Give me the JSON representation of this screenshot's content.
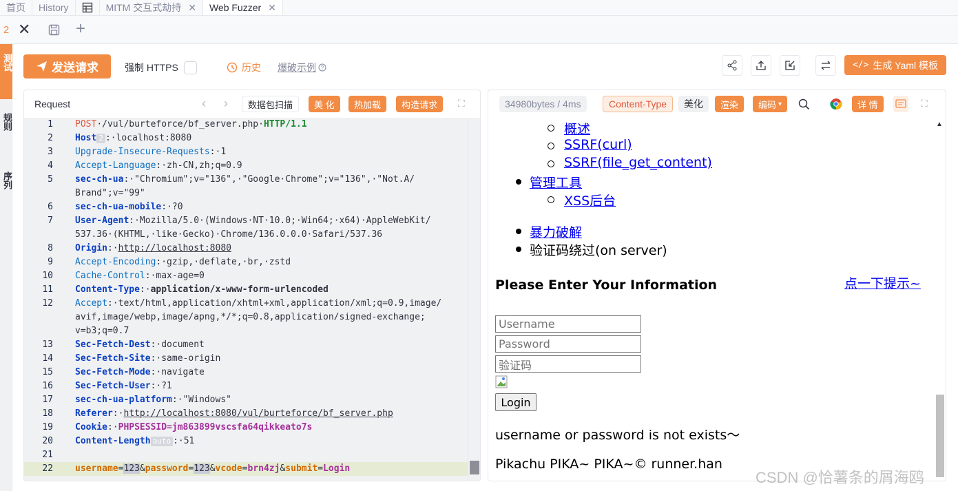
{
  "tabs": [
    "首页",
    "History",
    "MITM 交互式劫持",
    "Web Fuzzer"
  ],
  "subtab": {
    "number": "2"
  },
  "sidebar": {
    "labels": [
      "测试",
      "规则",
      "序列"
    ]
  },
  "toolbar": {
    "send_label": "发送请求",
    "https_label": "强制 HTTPS",
    "history_label": "历史",
    "example_label": "爆破示例",
    "yaml_label": "生成 Yaml 模板"
  },
  "request": {
    "title": "Request",
    "scan_label": "数据包扫描",
    "beautify_label": "美 化",
    "hotload_label": "热加载",
    "construct_label": "构造请求",
    "lines": [
      {
        "n": "1",
        "parts": [
          [
            "meth",
            "POST"
          ],
          [
            "val",
            "·/vul/burteforce/bf_server.php·"
          ],
          [
            "proto",
            "HTTP/1.1"
          ]
        ]
      },
      {
        "n": "2",
        "parts": [
          [
            "kb",
            "Host"
          ],
          [
            "tag",
            "2"
          ],
          [
            "val",
            ":·localhost:8080"
          ]
        ]
      },
      {
        "n": "3",
        "parts": [
          [
            "kn",
            "Upgrade-Insecure-Requests"
          ],
          [
            "val",
            ":·1"
          ]
        ]
      },
      {
        "n": "4",
        "parts": [
          [
            "kn",
            "Accept-Language"
          ],
          [
            "val",
            ":·zh-CN,zh;q=0.9"
          ]
        ]
      },
      {
        "n": "5",
        "parts": [
          [
            "kb",
            "sec-ch-ua"
          ],
          [
            "val",
            ":·\"Chromium\";v=\"136\",·\"Google·Chrome\";v=\"136\",·\"Not.A/\nBrand\";v=\"99\""
          ]
        ]
      },
      {
        "n": "6",
        "parts": [
          [
            "kb",
            "sec-ch-ua-mobile"
          ],
          [
            "val",
            ":·?0"
          ]
        ]
      },
      {
        "n": "7",
        "parts": [
          [
            "kb",
            "User-Agent"
          ],
          [
            "val",
            ":·Mozilla/5.0·(Windows·NT·10.0;·Win64;·x64)·AppleWebKit/\n537.36·(KHTML,·like·Gecko)·Chrome/136.0.0.0·Safari/537.36"
          ]
        ]
      },
      {
        "n": "8",
        "parts": [
          [
            "kb",
            "Origin"
          ],
          [
            "val",
            ":·"
          ],
          [
            "ul",
            "http://localhost:8080"
          ]
        ]
      },
      {
        "n": "9",
        "parts": [
          [
            "kn",
            "Accept-Encoding"
          ],
          [
            "val",
            ":·gzip,·deflate,·br,·zstd"
          ]
        ]
      },
      {
        "n": "10",
        "parts": [
          [
            "kn",
            "Cache-Control"
          ],
          [
            "val",
            ":·max-age=0"
          ]
        ]
      },
      {
        "n": "11",
        "parts": [
          [
            "kb",
            "Content-Type"
          ],
          [
            "val",
            ":·"
          ],
          [
            "bold",
            "application/x-www-form-urlencoded"
          ]
        ]
      },
      {
        "n": "12",
        "parts": [
          [
            "kn",
            "Accept"
          ],
          [
            "val",
            ":·text/html,application/xhtml+xml,application/xml;q=0.9,image/\navif,image/webp,image/apng,*/*;q=0.8,application/signed-exchange;\nv=b3;q=0.7"
          ]
        ]
      },
      {
        "n": "13",
        "parts": [
          [
            "kb",
            "Sec-Fetch-Dest"
          ],
          [
            "val",
            ":·document"
          ]
        ]
      },
      {
        "n": "14",
        "parts": [
          [
            "kb",
            "Sec-Fetch-Site"
          ],
          [
            "val",
            ":·same-origin"
          ]
        ]
      },
      {
        "n": "15",
        "parts": [
          [
            "kb",
            "Sec-Fetch-Mode"
          ],
          [
            "val",
            ":·navigate"
          ]
        ]
      },
      {
        "n": "16",
        "parts": [
          [
            "kb",
            "Sec-Fetch-User"
          ],
          [
            "val",
            ":·?1"
          ]
        ]
      },
      {
        "n": "17",
        "parts": [
          [
            "kb",
            "sec-ch-ua-platform"
          ],
          [
            "val",
            ":·\"Windows\""
          ]
        ]
      },
      {
        "n": "18",
        "parts": [
          [
            "kb",
            "Referer"
          ],
          [
            "val",
            ":·"
          ],
          [
            "ul",
            "http://localhost:8080/vul/burteforce/bf_server.php"
          ]
        ]
      },
      {
        "n": "19",
        "parts": [
          [
            "kb",
            "Cookie"
          ],
          [
            "val",
            ":·"
          ],
          [
            "ck",
            "PHPSESSID=jm863899vscsfa64qikkeato7s"
          ]
        ]
      },
      {
        "n": "20",
        "parts": [
          [
            "kb",
            "Content-Length"
          ],
          [
            "tag",
            "auto"
          ],
          [
            "val",
            ":·51"
          ]
        ]
      },
      {
        "n": "21",
        "parts": []
      },
      {
        "n": "22",
        "parts": [
          [
            "body-k",
            "username"
          ],
          [
            "val",
            "="
          ],
          [
            "body-h",
            "123"
          ],
          [
            "val",
            "&"
          ],
          [
            "body-k",
            "password"
          ],
          [
            "val",
            "="
          ],
          [
            "body-h",
            "123"
          ],
          [
            "val",
            "&"
          ],
          [
            "body-k",
            "vcode"
          ],
          [
            "val",
            "="
          ],
          [
            "body-v",
            "brn4zj"
          ],
          [
            "val",
            "&"
          ],
          [
            "body-k",
            "submit"
          ],
          [
            "val",
            "="
          ],
          [
            "body-v",
            "Login"
          ]
        ],
        "hl": true
      }
    ]
  },
  "response": {
    "size_label": "34980bytes / 4ms",
    "content_type_label": "Content-Type",
    "beautify_label": "美化",
    "render_label": "渲染",
    "encode_label": "编码",
    "detail_label": "详 情",
    "links_sub1": [
      "概述",
      "SSRF(curl)",
      "SSRF(file_get_content)"
    ],
    "menu_tools": "管理工具",
    "links_sub2": [
      "XSS后台"
    ],
    "menu_brute": "暴力破解",
    "menu_captcha": "验证码绕过(on server)",
    "heading": "Please Enter Your Information",
    "hint_link": "点一下提示~",
    "username_placeholder": "Username",
    "password_placeholder": "Password",
    "captcha_placeholder": "验证码",
    "login_label": "Login",
    "error_msg": "username or password is not exists～",
    "footer": "Pikachu PIKA~ PIKA~© runner.han"
  },
  "watermark": "CSDN @恰薯条的屑海鸥"
}
